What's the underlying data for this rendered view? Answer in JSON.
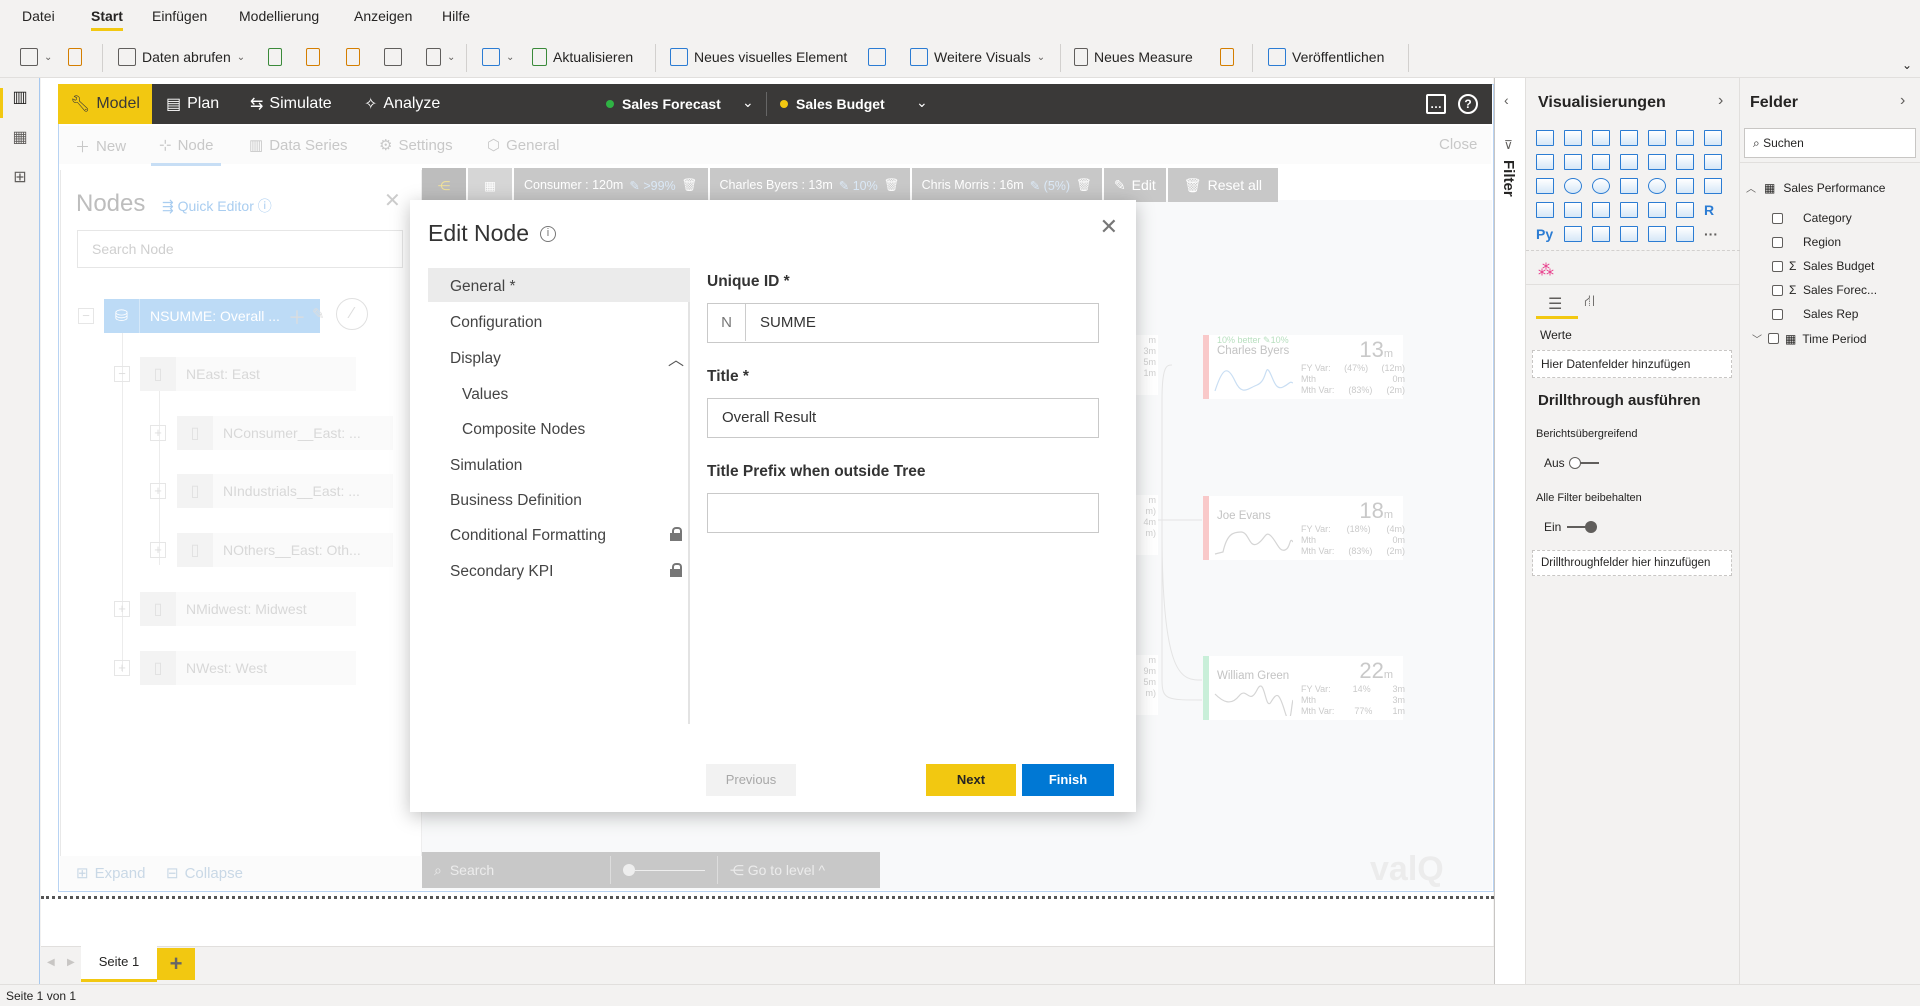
{
  "menu": {
    "items": [
      "Datei",
      "Start",
      "Einfügen",
      "Modellierung",
      "Anzeigen",
      "Hilfe"
    ],
    "active": "Start"
  },
  "toolbar": {
    "get_data": "Daten abrufen",
    "refresh": "Aktualisieren",
    "new_visual": "Neues visuelles Element",
    "more_visuals": "Weitere Visuals",
    "new_measure": "Neues Measure",
    "publish": "Veröffentlichen"
  },
  "valq": {
    "tabs": [
      "Model",
      "Plan",
      "Simulate",
      "Analyze"
    ],
    "active_tab": "Model",
    "scenarios": [
      {
        "label": "Sales Forecast",
        "color": "#2fb344"
      },
      {
        "label": "Sales Budget",
        "color": "#f2c811"
      }
    ],
    "subtoolbar": [
      "New",
      "Node",
      "Data Series",
      "Settings",
      "General"
    ],
    "active_sub": "Node",
    "close_label": "Close"
  },
  "nodes_panel": {
    "title": "Nodes",
    "quick_editor": "Quick Editor",
    "search_placeholder": "Search Node",
    "tree": [
      {
        "label": "NSUMME: Overall ...",
        "selected": true
      },
      {
        "label": "NEast: East"
      },
      {
        "label": "NConsumer__East: ..."
      },
      {
        "label": "NIndustrials__East: ..."
      },
      {
        "label": "NOthers__East: Oth..."
      },
      {
        "label": "NMidwest: Midwest"
      },
      {
        "label": "NWest: West"
      }
    ],
    "expand": "Expand",
    "collapse": "Collapse"
  },
  "tagbar": {
    "tags": [
      {
        "name": "Consumer : 120m",
        "pct": ">99%"
      },
      {
        "name": "Charles Byers : 13m",
        "pct": "10%"
      },
      {
        "name": "Chris Morris : 16m",
        "pct": "(5%)"
      }
    ],
    "edit": "Edit",
    "reset": "Reset all"
  },
  "cards": [
    {
      "name": "Charles Byers",
      "top": "10% better   ✎10%",
      "value": "13",
      "unit": "m",
      "rows": [
        [
          "FY Var:",
          "(47%)",
          "(12m)"
        ],
        [
          "Mth",
          "",
          "0m"
        ],
        [
          "Mth Var:",
          "(83%)",
          "(2m)"
        ]
      ]
    },
    {
      "name": "Joe Evans",
      "top": "",
      "value": "18",
      "unit": "m",
      "rows": [
        [
          "FY Var:",
          "(18%)",
          "(4m)"
        ],
        [
          "Mth",
          "",
          "0m"
        ],
        [
          "Mth Var:",
          "(83%)",
          "(2m)"
        ]
      ]
    },
    {
      "name": "William Green",
      "top": "",
      "value": "22",
      "unit": "m",
      "rows": [
        [
          "FY Var:",
          "14%",
          "3m"
        ],
        [
          "Mth",
          "",
          "3m"
        ],
        [
          "Mth Var:",
          "77%",
          "1m"
        ]
      ]
    }
  ],
  "tree_bottom": {
    "search_placeholder": "Search",
    "goto": "Go to level"
  },
  "logo": "valQ",
  "dialog": {
    "title": "Edit Node",
    "nav": [
      "General *",
      "Configuration",
      "Display",
      "Values",
      "Composite Nodes",
      "Simulation",
      "Business Definition",
      "Conditional Formatting",
      "Secondary KPI"
    ],
    "active_nav": "General *",
    "fields": {
      "unique_id_label": "Unique ID *",
      "unique_id_prefix": "N",
      "unique_id_value": "SUMME",
      "title_label": "Title *",
      "title_value": "Overall Result",
      "prefix_label": "Title Prefix when outside Tree",
      "prefix_value": ""
    },
    "buttons": {
      "previous": "Previous",
      "next": "Next",
      "finish": "Finish"
    }
  },
  "filter_pane": {
    "label": "Filter"
  },
  "viz_pane": {
    "title": "Visualisierungen",
    "values_label": "Werte",
    "add_fields": "Hier Datenfelder hinzufügen",
    "drillthrough_title": "Drillthrough ausführen",
    "cross_report": "Berichtsübergreifend",
    "cross_report_state": "Aus",
    "keep_filters": "Alle Filter beibehalten",
    "keep_filters_state": "Ein",
    "add_drill": "Drillthroughfelder hier hinzufügen"
  },
  "fields_pane": {
    "title": "Felder",
    "search_placeholder": "Suchen",
    "table": "Sales Performance",
    "fields": [
      {
        "name": "Category",
        "sigma": false
      },
      {
        "name": "Region",
        "sigma": false
      },
      {
        "name": "Sales Budget",
        "sigma": true
      },
      {
        "name": "Sales Forec...",
        "sigma": true
      },
      {
        "name": "Sales Rep",
        "sigma": false
      }
    ],
    "time_table": "Time Period"
  },
  "pages": {
    "tabs": [
      "Seite 1"
    ],
    "status": "Seite 1 von 1"
  }
}
